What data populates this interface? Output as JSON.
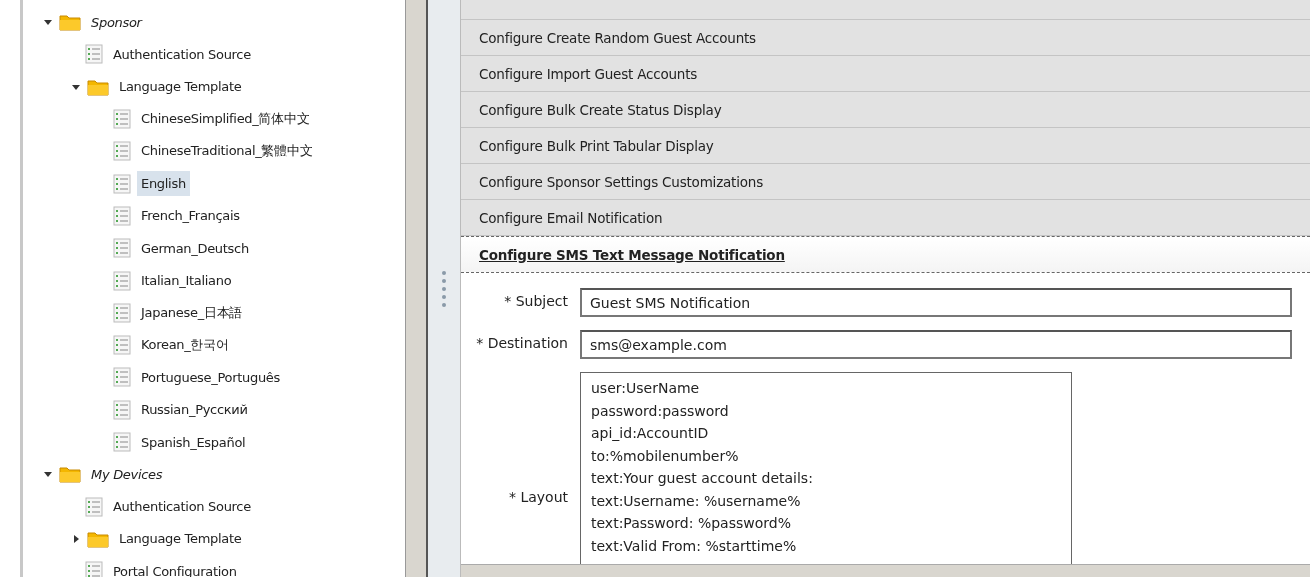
{
  "tree": [
    {
      "label": "Sponsor",
      "kind": "folder",
      "italic": true,
      "expanded": true,
      "selected": false,
      "children": [
        {
          "label": "Authentication Source",
          "kind": "page",
          "selected": false
        },
        {
          "label": "Language Template",
          "kind": "folder",
          "italic": false,
          "expanded": true,
          "selected": false,
          "children": [
            {
              "label": "ChineseSimplified_简体中文",
              "kind": "page",
              "selected": false
            },
            {
              "label": "ChineseTraditional_繁體中文",
              "kind": "page",
              "selected": false
            },
            {
              "label": "English",
              "kind": "page",
              "selected": true
            },
            {
              "label": "French_Français",
              "kind": "page",
              "selected": false
            },
            {
              "label": "German_Deutsch",
              "kind": "page",
              "selected": false
            },
            {
              "label": "Italian_Italiano",
              "kind": "page",
              "selected": false
            },
            {
              "label": "Japanese_日本語",
              "kind": "page",
              "selected": false
            },
            {
              "label": "Korean_한국어",
              "kind": "page",
              "selected": false
            },
            {
              "label": "Portuguese_Português",
              "kind": "page",
              "selected": false
            },
            {
              "label": "Russian_Русский",
              "kind": "page",
              "selected": false
            },
            {
              "label": "Spanish_Español",
              "kind": "page",
              "selected": false
            }
          ]
        }
      ]
    },
    {
      "label": "My Devices",
      "kind": "folder",
      "italic": true,
      "expanded": true,
      "selected": false,
      "children": [
        {
          "label": "Authentication Source",
          "kind": "page",
          "selected": false
        },
        {
          "label": "Language Template",
          "kind": "folder",
          "italic": false,
          "expanded": false,
          "selected": false
        },
        {
          "label": "Portal Configuration",
          "kind": "page",
          "selected": false
        }
      ]
    }
  ],
  "sections": [
    {
      "title": "Configure Create Random Guest Accounts",
      "expanded": false
    },
    {
      "title": "Configure Import Guest Accounts",
      "expanded": false
    },
    {
      "title": "Configure Bulk Create Status Display",
      "expanded": false
    },
    {
      "title": "Configure Bulk Print Tabular Display",
      "expanded": false
    },
    {
      "title": "Configure Sponsor Settings Customizations",
      "expanded": false
    },
    {
      "title": "Configure Email Notification",
      "expanded": false
    },
    {
      "title": "Configure SMS Text Message Notification",
      "expanded": true
    }
  ],
  "form": {
    "subject": {
      "label": "* Subject",
      "value": "Guest SMS Notification"
    },
    "destination": {
      "label": "* Destination",
      "value": "sms@example.com"
    },
    "layout": {
      "label": "* Layout",
      "lines": [
        "user:UserName",
        "password:password",
        "api_id:AccountID",
        "to:%mobilenumber%",
        "text:Your guest account details:",
        "text:Username: %username%",
        "text:Password: %password%",
        "text:Valid From: %starttime%"
      ]
    }
  }
}
